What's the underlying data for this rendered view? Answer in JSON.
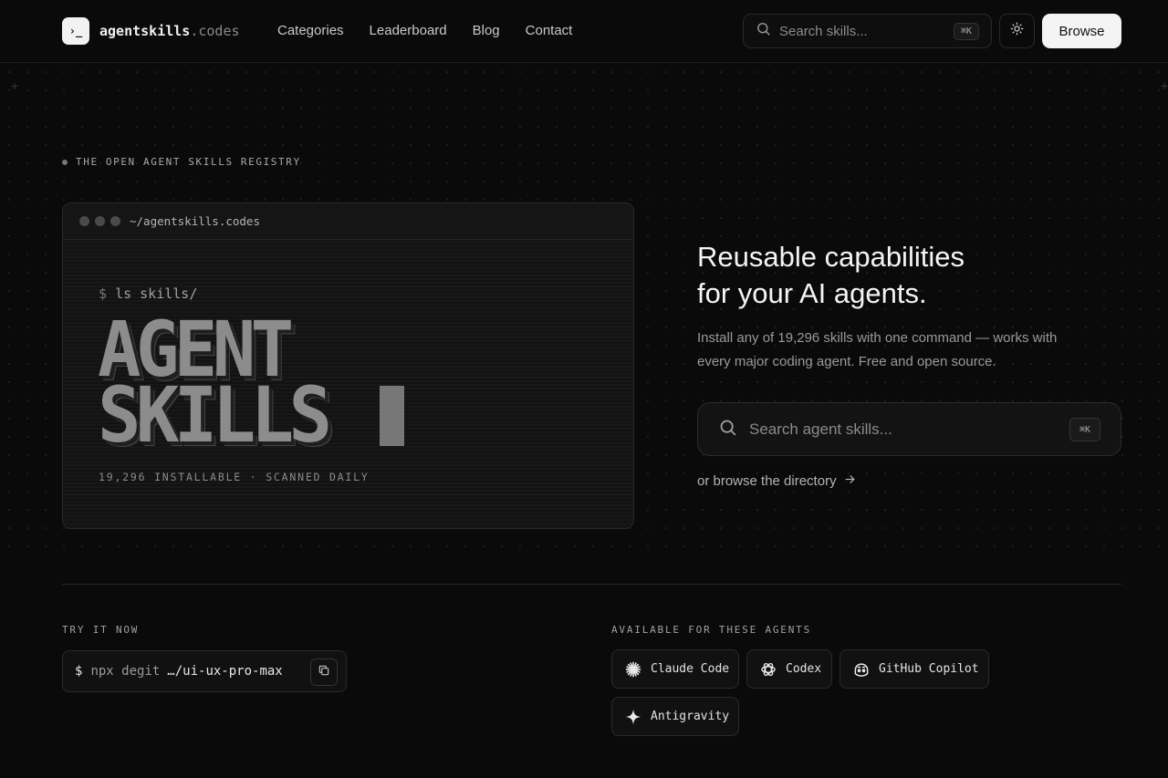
{
  "header": {
    "logo_glyph": "›_",
    "logo_name": "agentskills",
    "logo_suffix": ".codes",
    "nav": [
      {
        "label": "Categories"
      },
      {
        "label": "Leaderboard"
      },
      {
        "label": "Blog"
      },
      {
        "label": "Contact"
      }
    ],
    "search_placeholder": "Search skills...",
    "search_shortcut": "⌘K",
    "browse_label": "Browse"
  },
  "eyebrow": "THE OPEN AGENT SKILLS REGISTRY",
  "terminal": {
    "path": "~/agentskills.codes",
    "prompt_symbol": "$",
    "command": "ls skills/",
    "title_line1": "AGENT",
    "title_line2": "SKILLS",
    "footer": "19,296 INSTALLABLE · SCANNED DAILY"
  },
  "hero": {
    "title_line1": "Reusable capabilities",
    "title_line2": "for your AI agents.",
    "subtitle": "Install any of 19,296 skills with one command — works with every major coding agent. Free and open source.",
    "search_placeholder": "Search agent skills...",
    "search_shortcut": "⌘K",
    "directory_link": "or browse the directory"
  },
  "try_it": {
    "label": "TRY IT NOW",
    "prompt": "$",
    "command_prefix": "npx degit",
    "command_target": "…/ui-ux-pro-max"
  },
  "agents": {
    "label": "AVAILABLE FOR THESE AGENTS",
    "items": [
      {
        "name": "Claude Code",
        "icon": "claude-icon"
      },
      {
        "name": "Codex",
        "icon": "openai-icon"
      },
      {
        "name": "GitHub Copilot",
        "icon": "copilot-icon"
      },
      {
        "name": "Antigravity",
        "icon": "sparkle-icon"
      }
    ]
  }
}
